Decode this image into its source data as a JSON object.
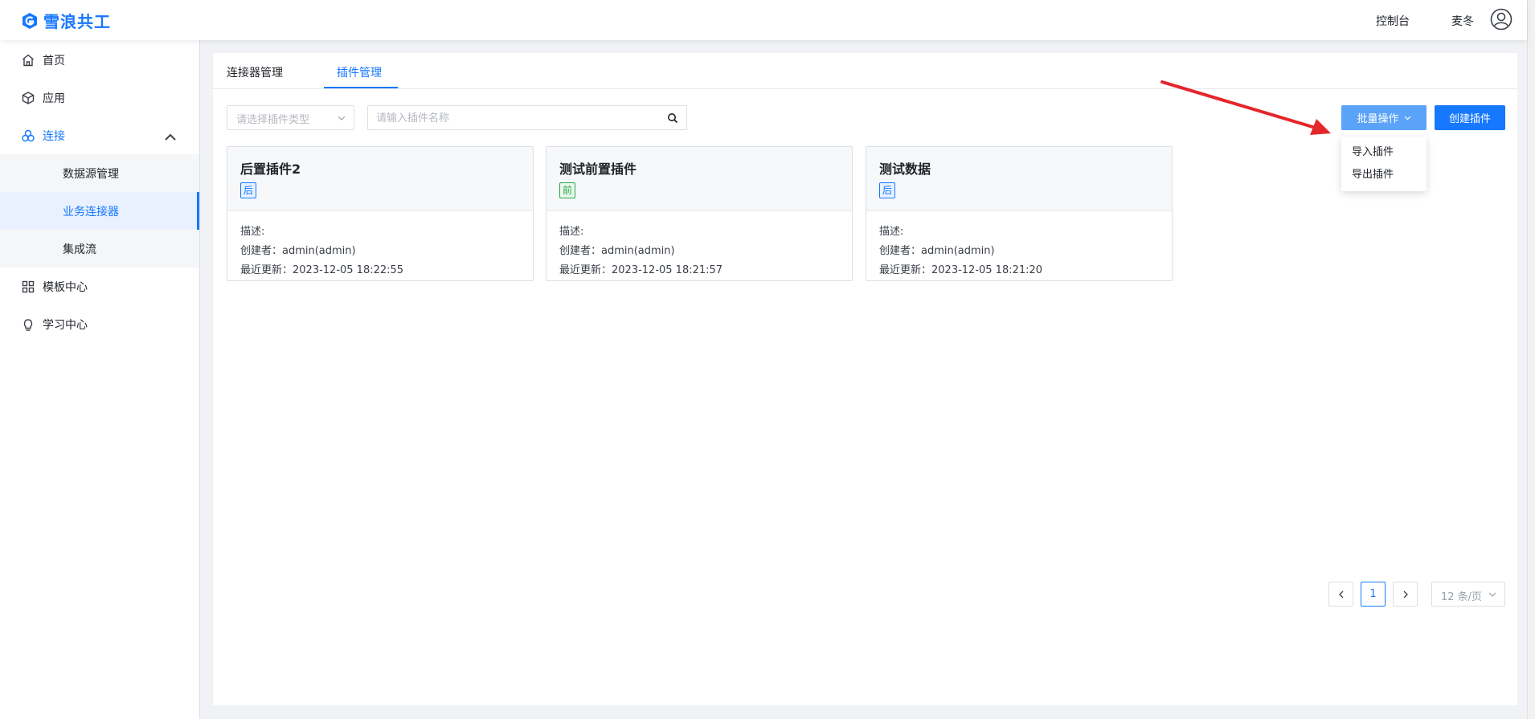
{
  "header": {
    "brand": "雪浪共工",
    "console_link": "控制台",
    "user_name": "麦冬"
  },
  "colors": {
    "primary": "#1677ff",
    "batch_button": "#5aa3f8",
    "front_tag": "#2ba84a",
    "annotation_arrow": "#e5262b"
  },
  "sidebar": {
    "items": [
      {
        "label": "首页",
        "icon": "home-icon"
      },
      {
        "label": "应用",
        "icon": "cube-icon"
      },
      {
        "label": "连接",
        "icon": "connection-icon"
      },
      {
        "label": "模板中心",
        "icon": "grid-icon"
      },
      {
        "label": "学习中心",
        "icon": "lightbulb-icon"
      }
    ],
    "sub_items": [
      {
        "label": "数据源管理"
      },
      {
        "label": "业务连接器"
      },
      {
        "label": "集成流"
      }
    ]
  },
  "tabs": [
    {
      "label": "连接器管理"
    },
    {
      "label": "插件管理"
    }
  ],
  "filters": {
    "type_placeholder": "请选择插件类型",
    "name_placeholder": "请输入插件名称"
  },
  "actions": {
    "batch_label": "批量操作",
    "create_label": "创建插件",
    "batch_menu": [
      {
        "label": "导入插件"
      },
      {
        "label": "导出插件"
      }
    ]
  },
  "cards": [
    {
      "title": "后置插件2",
      "tag": "后",
      "desc_label": "描述:",
      "creator_line": "创建者：admin(admin)",
      "updated_line": "最近更新：2023-12-05 18:22:55"
    },
    {
      "title": "测试前置插件",
      "tag": "前",
      "desc_label": "描述:",
      "creator_line": "创建者：admin(admin)",
      "updated_line": "最近更新：2023-12-05 18:21:57"
    },
    {
      "title": "测试数据",
      "tag": "后",
      "desc_label": "描述:",
      "creator_line": "创建者：admin(admin)",
      "updated_line": "最近更新：2023-12-05 18:21:20"
    }
  ],
  "pagination": {
    "current_page": "1",
    "page_size": "12 条/页"
  }
}
